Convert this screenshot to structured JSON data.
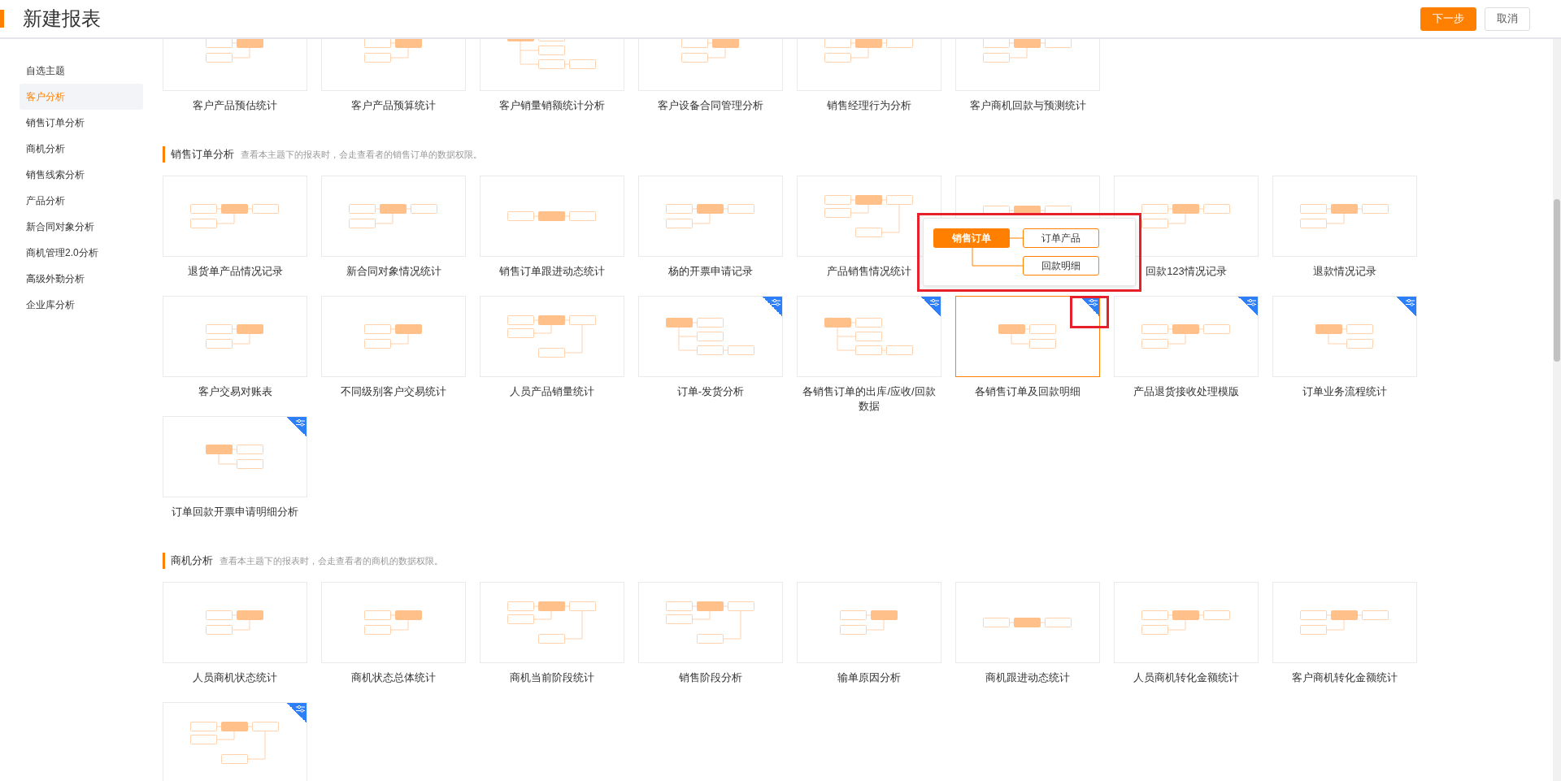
{
  "header": {
    "title": "新建报表",
    "buttons": [
      {
        "label": "下一步",
        "kind": "primary"
      },
      {
        "label": "取消",
        "kind": "default"
      }
    ]
  },
  "sidebar": {
    "items": [
      {
        "label": "自选主题",
        "selected": false
      },
      {
        "label": "客户分析",
        "selected": true
      },
      {
        "label": "销售订单分析",
        "selected": false
      },
      {
        "label": "商机分析",
        "selected": false
      },
      {
        "label": "销售线索分析",
        "selected": false
      },
      {
        "label": "产品分析",
        "selected": false
      },
      {
        "label": "新合同对象分析",
        "selected": false
      },
      {
        "label": "商机管理2.0分析",
        "selected": false
      },
      {
        "label": "高级外勤分析",
        "selected": false
      },
      {
        "label": "企业库分析",
        "selected": false
      }
    ]
  },
  "sections": [
    {
      "cards": [
        {
          "label": "客户产品预估统计",
          "kind": "left2",
          "custom": false,
          "selected": false
        },
        {
          "label": "客户产品预算统计",
          "kind": "left2",
          "custom": false,
          "selected": false
        },
        {
          "label": "客户销量销额统计分析",
          "kind": "branch3",
          "custom": false,
          "selected": false
        },
        {
          "label": "客户设备合同管理分析",
          "kind": "left2",
          "custom": false,
          "selected": false
        },
        {
          "label": "销售经理行为分析",
          "kind": "center",
          "custom": false,
          "selected": false
        },
        {
          "label": "客户商机回款与预测统计",
          "kind": "center",
          "custom": false,
          "selected": false
        }
      ]
    },
    {
      "title": "销售订单分析",
      "description": "查看本主题下的报表时，会走查看者的销售订单的数据权限。",
      "preview": {
        "root": "销售订单",
        "children": [
          "订单产品",
          "回款明细"
        ],
        "highlighted": true
      },
      "cards": [
        {
          "label": "退货单产品情况记录",
          "kind": "center",
          "custom": false,
          "selected": false
        },
        {
          "label": "新合同对象情况统计",
          "kind": "center",
          "custom": false,
          "selected": false
        },
        {
          "label": "销售订单跟进动态统计",
          "kind": "inline",
          "custom": false,
          "selected": false
        },
        {
          "label": "杨的开票申请记录",
          "kind": "center",
          "custom": false,
          "selected": false
        },
        {
          "label": "产品销售情况统计",
          "kind": "wide",
          "custom": false,
          "selected": false
        },
        {
          "kind": "covered",
          "custom": false,
          "selected": false
        },
        {
          "label": "回款123情况记录",
          "kind": "center",
          "custom": false,
          "selected": false
        },
        {
          "label": "退款情况记录",
          "kind": "center",
          "custom": false,
          "selected": false
        },
        {
          "label": "客户交易对账表",
          "kind": "left2",
          "custom": false,
          "selected": false
        },
        {
          "label": "不同级别客户交易统计",
          "kind": "left2",
          "custom": false,
          "selected": false
        },
        {
          "label": "人员产品销量统计",
          "kind": "wide",
          "custom": false,
          "selected": false
        },
        {
          "label": "订单-发货分析",
          "kind": "branch3",
          "custom": true,
          "selected": false
        },
        {
          "label": "各销售订单的出库/应收/回款数据",
          "kind": "branch3",
          "custom": true,
          "selected": false
        },
        {
          "label": "各销售订单及回款明细",
          "kind": "branch",
          "custom": true,
          "selected": true,
          "badge_highlighted": true
        },
        {
          "label": "产品退货接收处理模版",
          "kind": "center",
          "custom": true,
          "selected": false
        },
        {
          "label": "订单业务流程统计",
          "kind": "branch",
          "custom": true,
          "selected": false
        },
        {
          "label": "订单回款开票申请明细分析",
          "kind": "branch",
          "custom": true,
          "selected": false
        }
      ]
    },
    {
      "title": "商机分析",
      "description": "查看本主题下的报表时，会走查看者的商机的数据权限。",
      "cards": [
        {
          "label": "人员商机状态统计",
          "kind": "left2",
          "custom": false,
          "selected": false
        },
        {
          "label": "商机状态总体统计",
          "kind": "left2",
          "custom": false,
          "selected": false
        },
        {
          "label": "商机当前阶段统计",
          "kind": "wide",
          "custom": false,
          "selected": false
        },
        {
          "label": "销售阶段分析",
          "kind": "wide",
          "custom": false,
          "selected": false
        },
        {
          "label": "输单原因分析",
          "kind": "left2",
          "custom": false,
          "selected": false
        },
        {
          "label": "商机跟进动态统计",
          "kind": "inline",
          "custom": false,
          "selected": false
        },
        {
          "label": "人员商机转化金额统计",
          "kind": "center",
          "custom": false,
          "selected": false
        },
        {
          "label": "客户商机转化金额统计",
          "kind": "center",
          "custom": false,
          "selected": false
        },
        {
          "kind": "wide",
          "custom": true,
          "selected": false
        }
      ]
    }
  ]
}
